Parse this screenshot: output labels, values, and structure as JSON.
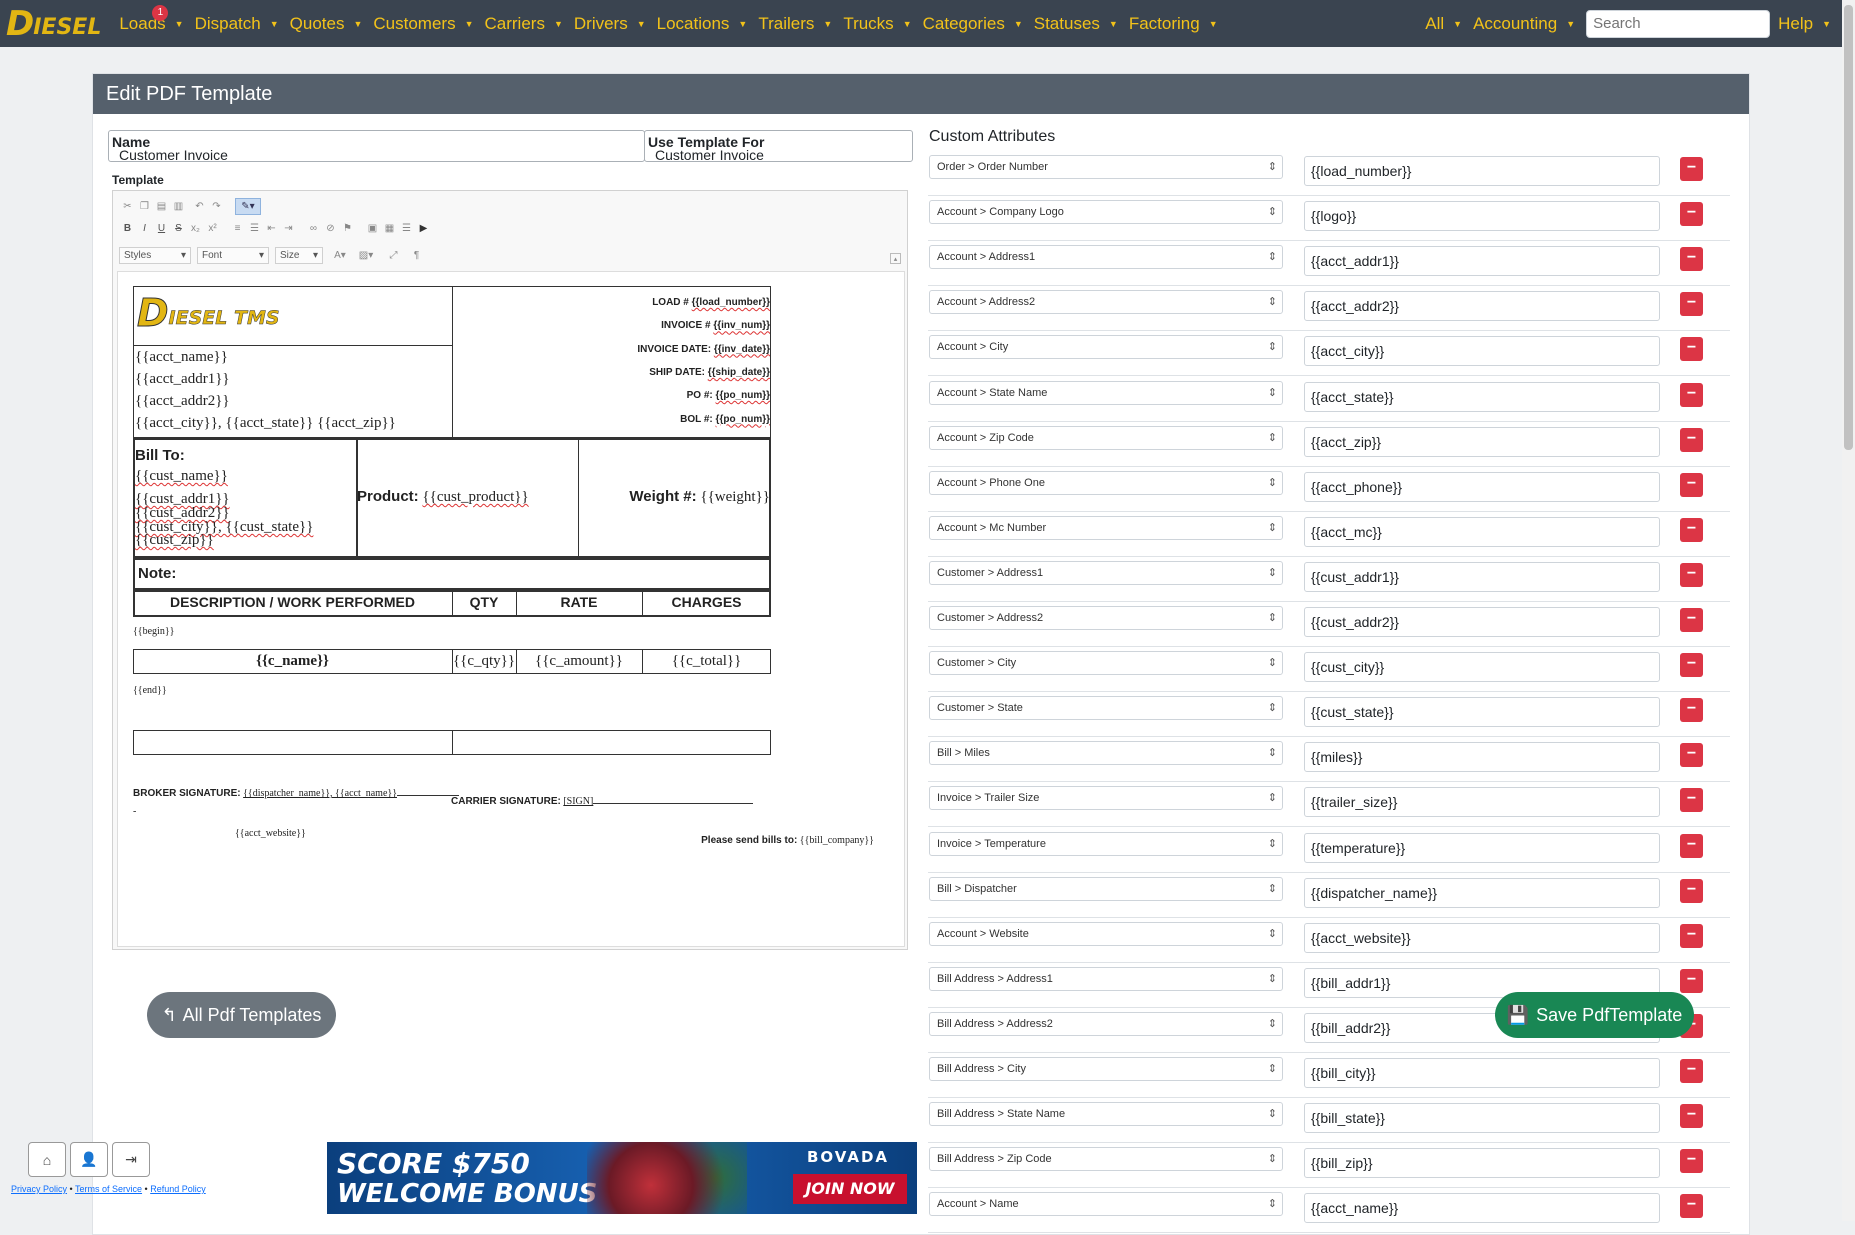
{
  "navbar": {
    "brand": {
      "d": "D",
      "rest": "IESEL"
    },
    "items": [
      {
        "label": "Loads",
        "badge": "1"
      },
      {
        "label": "Dispatch"
      },
      {
        "label": "Quotes"
      },
      {
        "label": "Customers"
      },
      {
        "label": "Carriers"
      },
      {
        "label": "Drivers"
      },
      {
        "label": "Locations"
      },
      {
        "label": "Trailers"
      },
      {
        "label": "Trucks"
      },
      {
        "label": "Categories"
      },
      {
        "label": "Statuses"
      },
      {
        "label": "Factoring"
      }
    ],
    "right": {
      "all": "All",
      "accounting": "Accounting",
      "search_placeholder": "Search",
      "help": "Help"
    }
  },
  "card": {
    "title": "Edit PDF Template"
  },
  "form": {
    "name_label": "Name",
    "name_value": "Customer Invoice",
    "use_for_label": "Use Template For",
    "use_for_value": "Customer Invoice",
    "template_label": "Template"
  },
  "editor": {
    "styles": "Styles",
    "font": "Font",
    "size": "Size",
    "logo": {
      "d": "D",
      "rest": "IESEL TMS"
    },
    "account_lines": [
      "{{acct_name}}",
      "{{acct_addr1}}",
      "{{acct_addr2}}",
      "{{acct_city}}, {{acct_state}} {{acct_zip}}"
    ],
    "header_fields": [
      {
        "label": "LOAD # ",
        "value": "{{load_number}}"
      },
      {
        "label": "INVOICE # ",
        "value": "{{inv_num}}"
      },
      {
        "label": "INVOICE DATE: ",
        "value": "{{inv_date}}"
      },
      {
        "label": "SHIP DATE: ",
        "value": "{{ship_date}}"
      },
      {
        "label": "PO #: ",
        "value": "{{po_num}}"
      },
      {
        "label": "BOL #: ",
        "value": "{{po_num}}"
      }
    ],
    "bill_to_label": "Bill To:",
    "bill_to_lines": [
      "{{cust_name}}",
      "{{cust_addr1}}",
      "{{cust_addr2}}",
      "{{cust_city}}, {{cust_state}}",
      "{{cust_zip}}"
    ],
    "product_label": "Product:",
    "product_value": "{{cust_product}}",
    "weight_label": "Weight #:",
    "weight_value": "{{weight}}",
    "note_label": "Note:",
    "columns": [
      "DESCRIPTION / WORK PERFORMED",
      "QTY",
      "RATE",
      "CHARGES"
    ],
    "begin_tag": "{{begin}}",
    "row": [
      "{{c_name}}",
      "{{c_qty}}",
      "{{c_amount}}",
      "{{c_total}}"
    ],
    "end_tag": "{{end}}",
    "broker_sig_label": "BROKER SIGNATURE:",
    "broker_sig_value": "{{dispatcher_name}}, {{acct_name}}",
    "carrier_sig_label": "CARRIER SIGNATURE:",
    "carrier_sig_value": "[SIGN]",
    "dash": "-",
    "website": "{{acct_website}}",
    "bills_note_label": "Please send bills to:",
    "bills_note_value": "{{bill_company}}"
  },
  "attributes": {
    "title": "Custom Attributes",
    "rows": [
      {
        "field": "Order > Order Number",
        "tag": "{{load_number}}"
      },
      {
        "field": "Account > Company Logo",
        "tag": "{{logo}}"
      },
      {
        "field": "Account > Address1",
        "tag": "{{acct_addr1}}"
      },
      {
        "field": "Account > Address2",
        "tag": "{{acct_addr2}}"
      },
      {
        "field": "Account > City",
        "tag": "{{acct_city}}"
      },
      {
        "field": "Account > State Name",
        "tag": "{{acct_state}}"
      },
      {
        "field": "Account > Zip Code",
        "tag": "{{acct_zip}}"
      },
      {
        "field": "Account > Phone One",
        "tag": "{{acct_phone}}"
      },
      {
        "field": "Account > Mc Number",
        "tag": "{{acct_mc}}"
      },
      {
        "field": "Customer > Address1",
        "tag": "{{cust_addr1}}"
      },
      {
        "field": "Customer > Address2",
        "tag": "{{cust_addr2}}"
      },
      {
        "field": "Customer > City",
        "tag": "{{cust_city}}"
      },
      {
        "field": "Customer > State",
        "tag": "{{cust_state}}"
      },
      {
        "field": "Bill > Miles",
        "tag": "{{miles}}"
      },
      {
        "field": "Invoice > Trailer Size",
        "tag": "{{trailer_size}}"
      },
      {
        "field": "Invoice > Temperature",
        "tag": "{{temperature}}"
      },
      {
        "field": "Bill > Dispatcher",
        "tag": "{{dispatcher_name}}"
      },
      {
        "field": "Account > Website",
        "tag": "{{acct_website}}"
      },
      {
        "field": "Bill Address > Address1",
        "tag": "{{bill_addr1}}"
      },
      {
        "field": "Bill Address > Address2",
        "tag": "{{bill_addr2}}"
      },
      {
        "field": "Bill Address > City",
        "tag": "{{bill_city}}"
      },
      {
        "field": "Bill Address > State Name",
        "tag": "{{bill_state}}"
      },
      {
        "field": "Bill Address > Zip Code",
        "tag": "{{bill_zip}}"
      },
      {
        "field": "Account > Name",
        "tag": "{{acct_name}}"
      }
    ]
  },
  "buttons": {
    "back": "All Pdf Templates",
    "save": "Save PdfTemplate"
  },
  "footer": {
    "privacy": "Privacy Policy",
    "terms": "Terms of Service",
    "refund": "Refund Policy",
    "sep": " • "
  },
  "ad": {
    "line1": "SCORE $750",
    "line2": "WELCOME BONUS",
    "brand": "BOVADA",
    "cta": "JOIN NOW"
  },
  "colors": {
    "nav_bg": "#3a4450",
    "nav_text": "#f2c21a",
    "header_bg": "#55606c",
    "danger": "#dc3545",
    "success": "#198754",
    "secondary": "#6c757d"
  }
}
